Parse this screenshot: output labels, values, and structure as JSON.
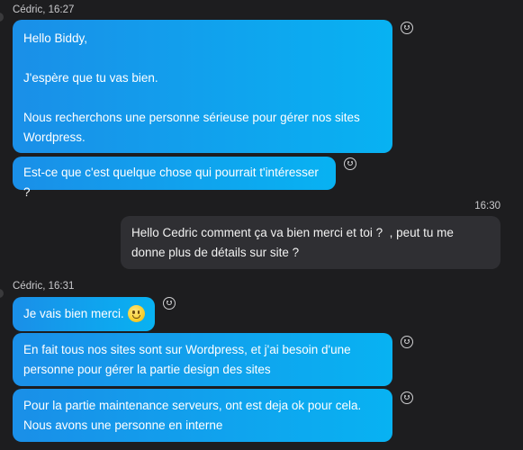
{
  "conversation": {
    "group1": {
      "sender": "Cédric, 16:27",
      "messages": [
        "Hello Biddy,\n\nJ'espère que tu vas bien.\n\nNous recherchons une personne sérieuse pour gérer nos sites Wordpress.",
        "Est-ce que c'est quelque chose qui pourrait t'intéresser ?"
      ]
    },
    "group2": {
      "time": "16:30",
      "message": "Hello Cedric comment ça va bien merci et toi ?  , peut tu me donne plus de détails sur site ?"
    },
    "group3": {
      "sender": "Cédric, 16:31",
      "messages": [
        "Je vais bien merci.",
        "En fait tous nos sites sont sur Wordpress, et j'ai besoin d'une personne pour gérer la partie design des sites",
        "Pour la partie maintenance serveurs, ont est deja ok pour cela. Nous avons une personne en interne"
      ]
    }
  },
  "icons": {
    "reaction": "smiley-outline-icon",
    "emoji": "slightly-smiling-face-emoji"
  },
  "colors": {
    "background": "#1d1d1f",
    "incoming_start": "#1a8fe8",
    "incoming_end": "#08b2f2",
    "outgoing": "#2f2f33",
    "meta_text": "#c9c9cc"
  }
}
